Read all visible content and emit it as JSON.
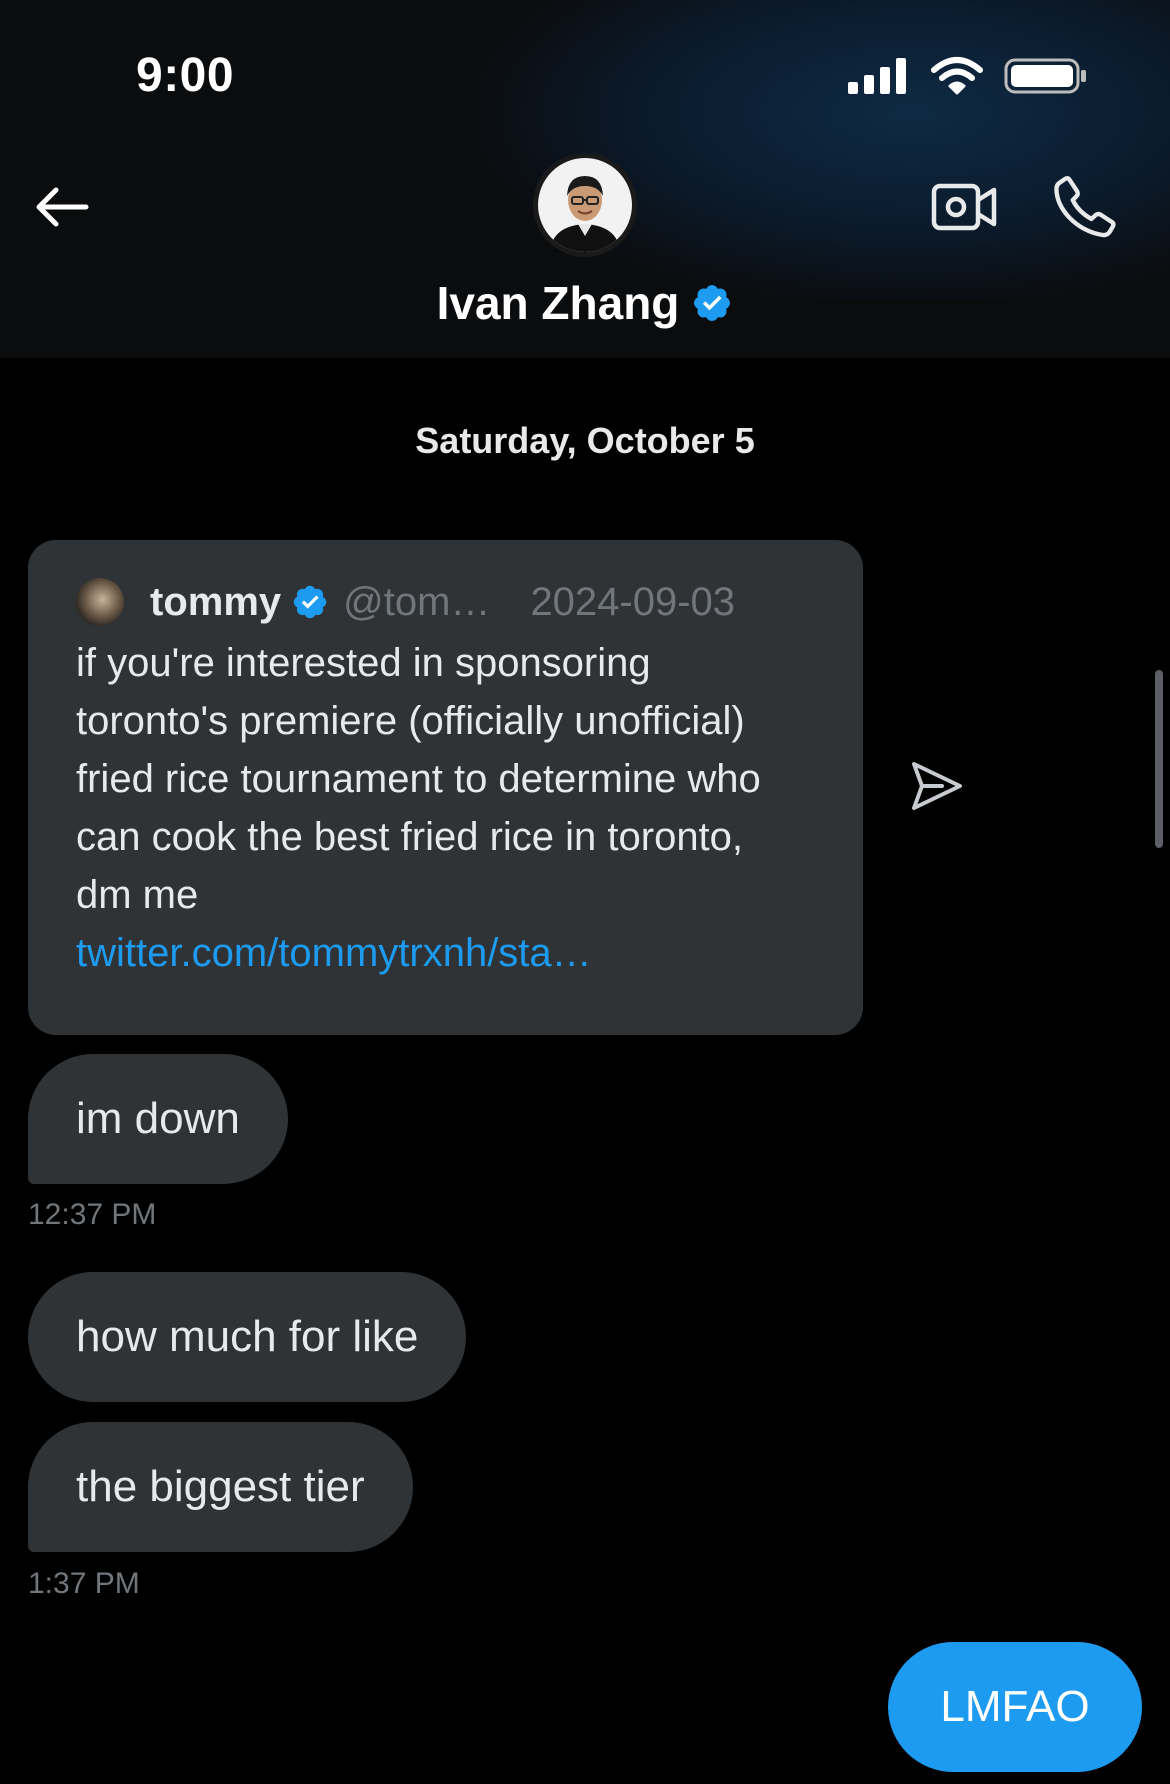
{
  "status_bar": {
    "time": "9:00"
  },
  "header": {
    "contact_name": "Ivan Zhang",
    "verified": true
  },
  "conversation": {
    "date_separator": "Saturday, October 5",
    "shared_tweet": {
      "author": "tommy",
      "handle": "@tom…",
      "date": "2024-09-03",
      "text": "if you're interested in sponsoring toronto's premiere (officially unofficial) fried rice tournament to determine who can cook the best fried rice in toronto, dm me",
      "link": "twitter.com/tommytrxnh/sta…"
    },
    "messages": [
      {
        "text": "im down",
        "time": "12:37 PM"
      },
      {
        "text": "how much for like"
      },
      {
        "text": "the biggest tier",
        "time": "1:37 PM"
      }
    ],
    "outgoing": [
      {
        "text": "LMFAO"
      }
    ]
  },
  "colors": {
    "background": "#000000",
    "bubble_incoming": "#2f3336",
    "bubble_outgoing": "#1d9bf0",
    "verified_blue": "#1d9bf0",
    "secondary_text": "#71767b",
    "link": "#1d9bf0"
  },
  "icons": {
    "back": "arrow-left-icon",
    "video": "video-camera-icon",
    "phone": "phone-icon",
    "share": "send-icon",
    "verified": "verified-badge-icon",
    "signal": "cellular-signal-icon",
    "wifi": "wifi-icon",
    "battery": "battery-icon"
  }
}
